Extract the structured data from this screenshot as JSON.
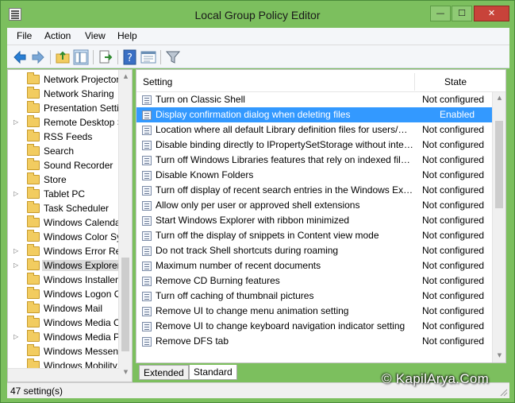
{
  "window": {
    "title": "Local Group Policy Editor",
    "minimize_glyph": "—",
    "maximize_glyph": "☐",
    "close_glyph": "✕"
  },
  "menu": [
    "File",
    "Action",
    "View",
    "Help"
  ],
  "toolbar": {
    "icons": [
      "back-arrow-icon",
      "forward-arrow-icon",
      "folder-up-icon",
      "show-hide-tree-icon",
      "export-list-icon",
      "help-icon",
      "properties-icon",
      "filter-icon"
    ]
  },
  "tree": {
    "items": [
      {
        "label": "Network Projector",
        "expandable": false
      },
      {
        "label": "Network Sharing",
        "expandable": false
      },
      {
        "label": "Presentation Settings",
        "expandable": false
      },
      {
        "label": "Remote Desktop Services",
        "expandable": true
      },
      {
        "label": "RSS Feeds",
        "expandable": false
      },
      {
        "label": "Search",
        "expandable": false
      },
      {
        "label": "Sound Recorder",
        "expandable": false
      },
      {
        "label": "Store",
        "expandable": false
      },
      {
        "label": "Tablet PC",
        "expandable": true
      },
      {
        "label": "Task Scheduler",
        "expandable": false
      },
      {
        "label": "Windows Calendar",
        "expandable": false
      },
      {
        "label": "Windows Color System",
        "expandable": false
      },
      {
        "label": "Windows Error Reporting",
        "expandable": true
      },
      {
        "label": "Windows Explorer",
        "expandable": true,
        "selected": true
      },
      {
        "label": "Windows Installer",
        "expandable": false
      },
      {
        "label": "Windows Logon Options",
        "expandable": false
      },
      {
        "label": "Windows Mail",
        "expandable": false
      },
      {
        "label": "Windows Media Center",
        "expandable": false
      },
      {
        "label": "Windows Media Player",
        "expandable": true
      },
      {
        "label": "Windows Messenger",
        "expandable": false
      },
      {
        "label": "Windows Mobility Center",
        "expandable": false
      }
    ]
  },
  "columns": {
    "setting": "Setting",
    "state": "State"
  },
  "settings": [
    {
      "name": "Turn on Classic Shell",
      "state": "Not configured"
    },
    {
      "name": "Display confirmation dialog when deleting files",
      "state": "Enabled",
      "selected": true
    },
    {
      "name": "Location where all default Library definition files for users/machines reside",
      "state": "Not configured"
    },
    {
      "name": "Disable binding directly to IPropertySetStorage without intermediate layers",
      "state": "Not configured"
    },
    {
      "name": "Turn off Windows Libraries features that rely on indexed file data",
      "state": "Not configured"
    },
    {
      "name": "Disable Known Folders",
      "state": "Not configured"
    },
    {
      "name": "Turn off display of recent search entries in the Windows Explorer search box",
      "state": "Not configured"
    },
    {
      "name": "Allow only per user or approved shell extensions",
      "state": "Not configured"
    },
    {
      "name": "Start Windows Explorer with ribbon minimized",
      "state": "Not configured"
    },
    {
      "name": "Turn off the display of snippets in Content view mode",
      "state": "Not configured"
    },
    {
      "name": "Do not track Shell shortcuts during roaming",
      "state": "Not configured"
    },
    {
      "name": "Maximum number of recent documents",
      "state": "Not configured"
    },
    {
      "name": "Remove CD Burning features",
      "state": "Not configured"
    },
    {
      "name": "Turn off caching of thumbnail pictures",
      "state": "Not configured"
    },
    {
      "name": "Remove UI to change menu animation setting",
      "state": "Not configured"
    },
    {
      "name": "Remove UI to change keyboard navigation indicator setting",
      "state": "Not configured"
    },
    {
      "name": "Remove DFS tab",
      "state": "Not configured"
    }
  ],
  "tabs": [
    "Extended",
    "Standard"
  ],
  "status": "47 setting(s)",
  "watermark": "© KapilArya.Com"
}
